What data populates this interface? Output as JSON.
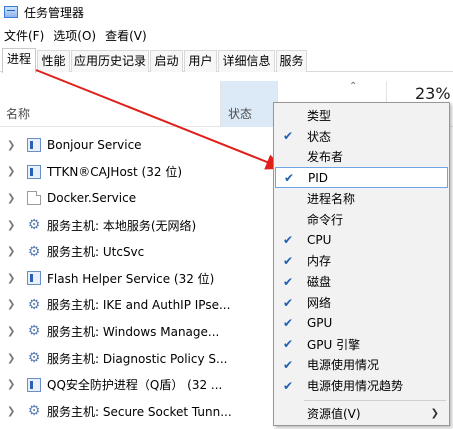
{
  "window": {
    "title": "任务管理器"
  },
  "menu": [
    "文件(F)",
    "选项(O)",
    "查看(V)"
  ],
  "tabs": [
    "进程",
    "性能",
    "应用历史记录",
    "启动",
    "用户",
    "详细信息",
    "服务"
  ],
  "header": {
    "name": "名称",
    "status": "状态",
    "cpu_percent": "23%"
  },
  "processes": [
    {
      "name": "Bonjour Service",
      "icon": "service-icon"
    },
    {
      "name": "TTKN®CAJHost (32 位)",
      "icon": "service-icon"
    },
    {
      "name": "Docker.Service",
      "icon": "file-icon"
    },
    {
      "name": "服务主机: 本地服务(无网络)",
      "icon": "gear-icon"
    },
    {
      "name": "服务主机: UtcSvc",
      "icon": "gear-icon"
    },
    {
      "name": "Flash Helper Service (32 位)",
      "icon": "service-icon"
    },
    {
      "name": "服务主机: IKE and AuthIP IPse...",
      "icon": "gear-icon"
    },
    {
      "name": "服务主机: Windows Manage...",
      "icon": "gear-icon"
    },
    {
      "name": "服务主机: Diagnostic Policy S...",
      "icon": "gear-icon"
    },
    {
      "name": "QQ安全防护进程（Q盾） (32 ...",
      "icon": "service-icon"
    },
    {
      "name": "服务主机: Secure Socket Tunn...",
      "icon": "gear-icon"
    }
  ],
  "context_menu": [
    {
      "label": "类型",
      "checked": false
    },
    {
      "label": "状态",
      "checked": true
    },
    {
      "label": "发布者",
      "checked": false
    },
    {
      "label": "PID",
      "checked": true
    },
    {
      "label": "进程名称",
      "checked": false
    },
    {
      "label": "命令行",
      "checked": false
    },
    {
      "label": "CPU",
      "checked": true
    },
    {
      "label": "内存",
      "checked": true
    },
    {
      "label": "磁盘",
      "checked": true
    },
    {
      "label": "网络",
      "checked": true
    },
    {
      "label": "GPU",
      "checked": true
    },
    {
      "label": "GPU 引擎",
      "checked": true
    },
    {
      "label": "电源使用情况",
      "checked": true
    },
    {
      "label": "电源使用情况趋势",
      "checked": true
    },
    {
      "label": "资源值(V)",
      "checked": false,
      "submenu": true
    }
  ],
  "colors": {
    "accent": "#1f5fb4",
    "arrow": "#e0201b",
    "status_col_bg": "#dceaf7"
  }
}
